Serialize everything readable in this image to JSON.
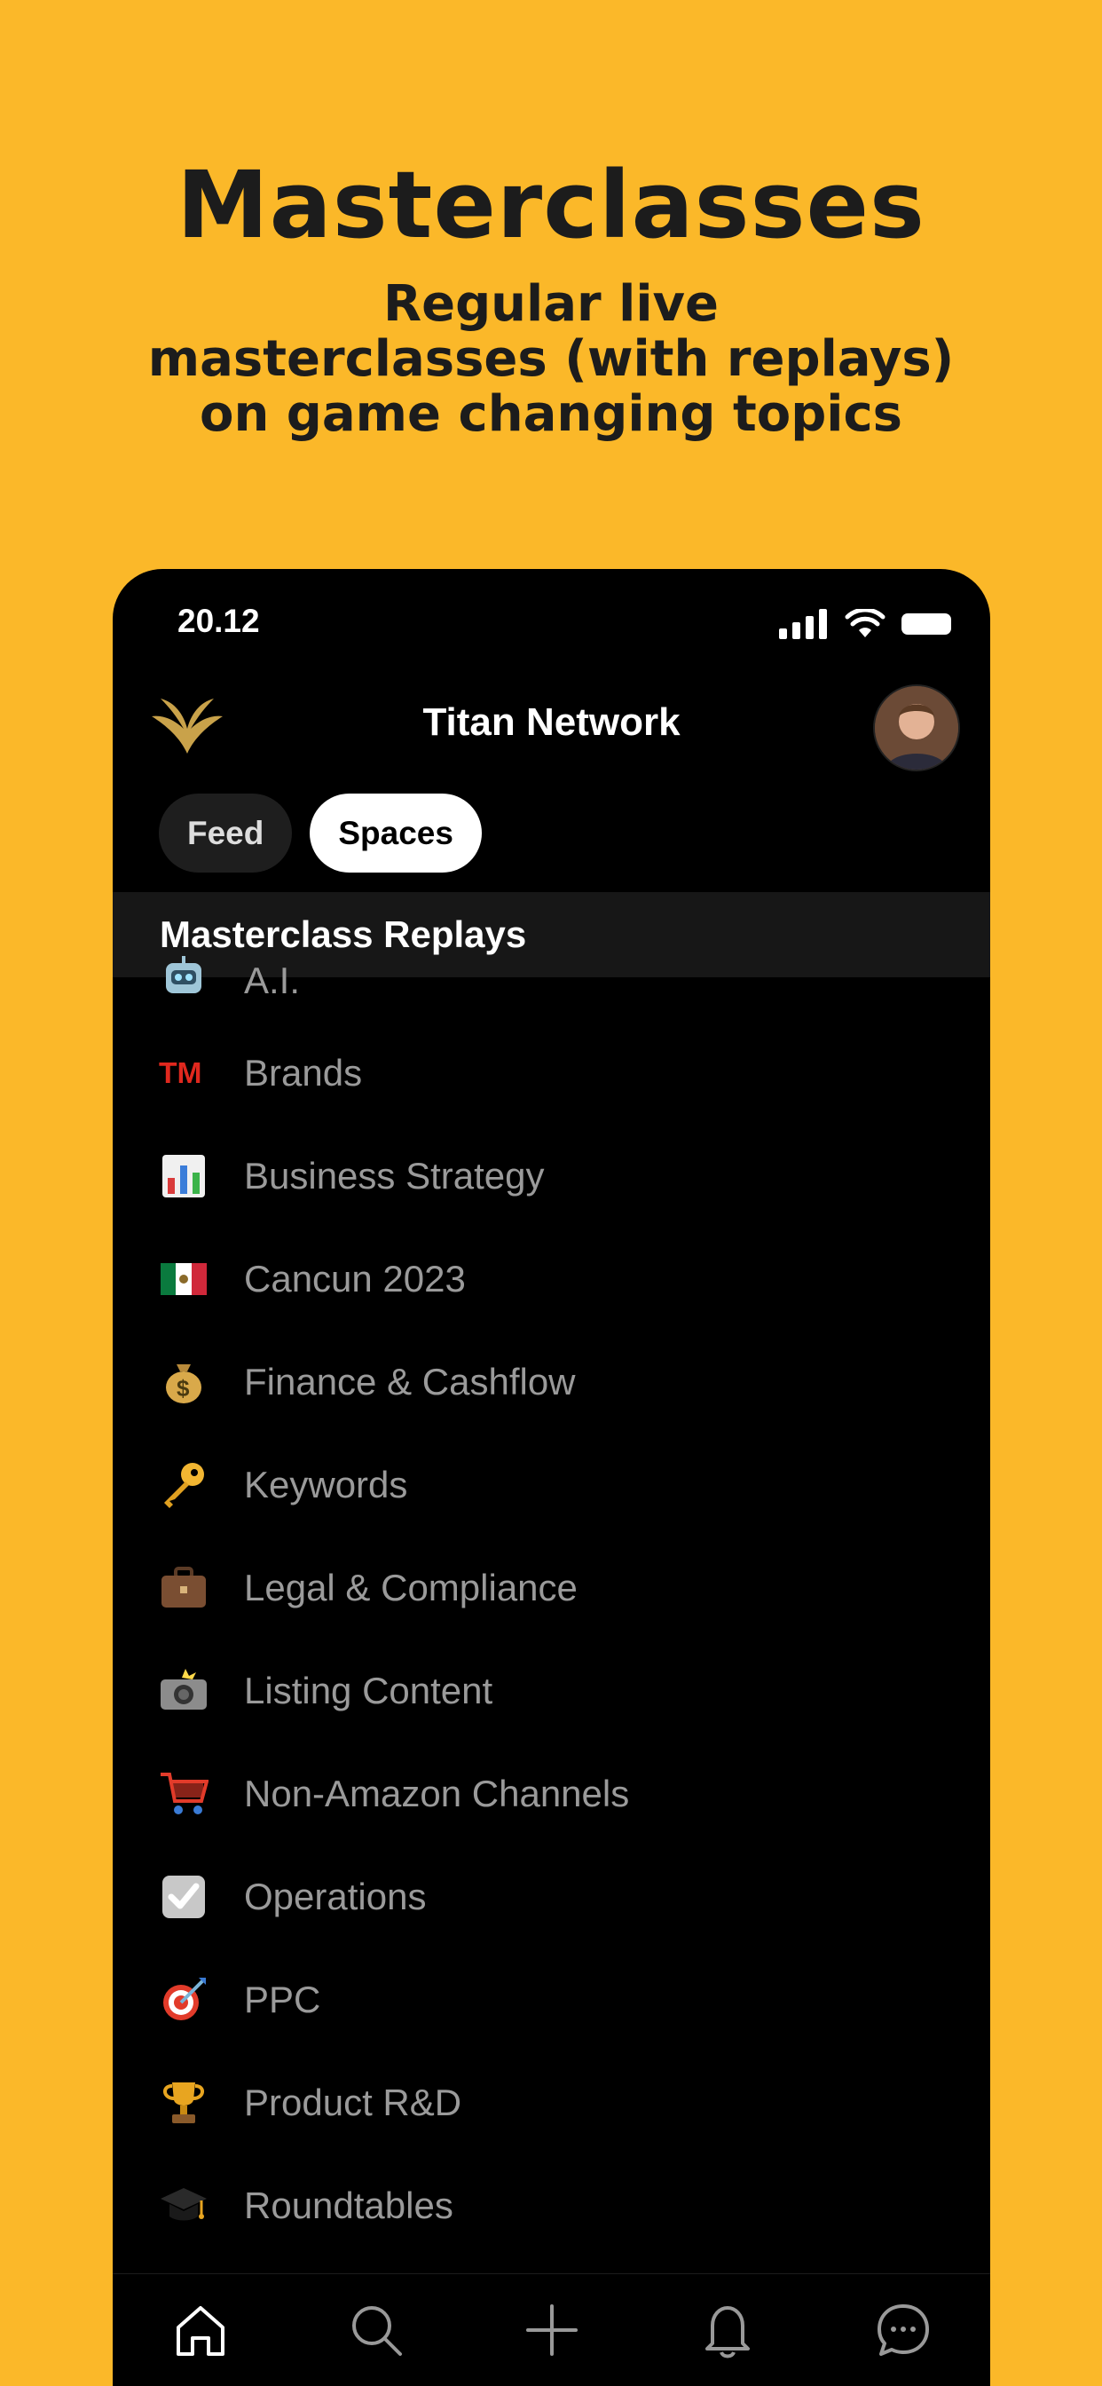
{
  "promo": {
    "headline": "Masterclasses",
    "subline_1": "Regular live",
    "subline_2": "masterclasses (with replays)",
    "subline_3": "on game changing topics"
  },
  "status_bar": {
    "time": "20.12"
  },
  "header": {
    "title": "Titan Network"
  },
  "tabs": [
    {
      "label": "Feed",
      "active": false
    },
    {
      "label": "Spaces",
      "active": true
    }
  ],
  "section": {
    "title": "Masterclass Replays"
  },
  "spaces": [
    {
      "icon": "robot-icon",
      "label": "A.I."
    },
    {
      "icon": "trademark-icon",
      "label": "Brands"
    },
    {
      "icon": "bar-chart-icon",
      "label": "Business Strategy"
    },
    {
      "icon": "mexico-flag-icon",
      "label": "Cancun 2023"
    },
    {
      "icon": "money-bag-icon",
      "label": "Finance & Cashflow"
    },
    {
      "icon": "key-icon",
      "label": "Keywords"
    },
    {
      "icon": "briefcase-icon",
      "label": "Legal & Compliance"
    },
    {
      "icon": "camera-flash-icon",
      "label": "Listing Content"
    },
    {
      "icon": "shopping-cart-icon",
      "label": "Non-Amazon Channels"
    },
    {
      "icon": "check-box-icon",
      "label": "Operations"
    },
    {
      "icon": "target-icon",
      "label": "PPC"
    },
    {
      "icon": "trophy-icon",
      "label": "Product R&D"
    },
    {
      "icon": "graduation-cap-icon",
      "label": "Roundtables"
    }
  ],
  "tab_bar": [
    "home-icon",
    "search-icon",
    "plus-icon",
    "bell-icon",
    "chat-bubble-icon"
  ],
  "colors": {
    "background": "#FBB829",
    "accent_gold": "#C9A24A",
    "tm_red": "#E0281E"
  }
}
